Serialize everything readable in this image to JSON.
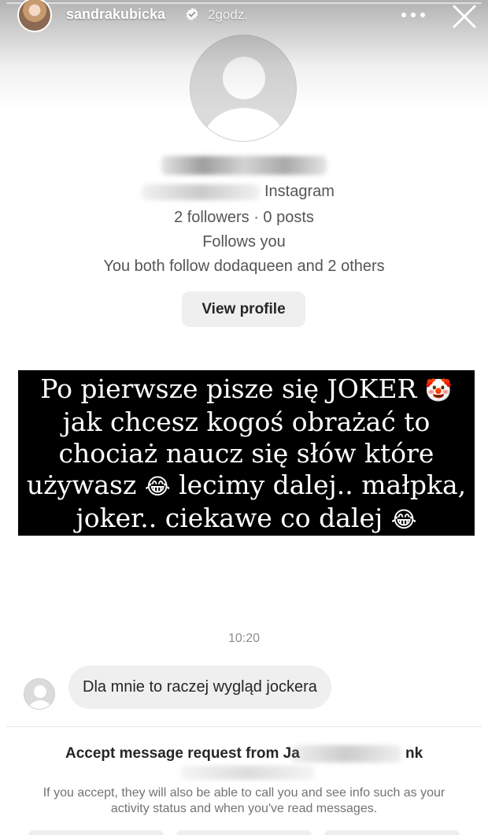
{
  "story": {
    "username": "sandrakubicka",
    "time_ago": "2godz.",
    "verified": true,
    "icons": [
      "verified-badge-icon",
      "more-dots-icon",
      "close-icon"
    ]
  },
  "profile_card": {
    "platform": "Instagram",
    "followers_line": "2 followers · 0 posts",
    "follows_you": "Follows you",
    "mutual_line": "You both follow dodaqueen and 2 others",
    "view_profile_label": "View profile"
  },
  "caption": {
    "text_before_clown": "Po pierwsze pisze się JOKER",
    "clown_emoji": "🤡",
    "text_middle": "jak chcesz kogoś obrażać to chociaż naucz się słów które używasz",
    "laugh_emoji_1": "😂",
    "text_after": "lecimy dalej.. małpka, joker.. ciekawe co dalej",
    "laugh_emoji_2": "😂"
  },
  "chat": {
    "timestamp": "10:20",
    "message": "Dla mnie to raczej wygląd jockera"
  },
  "request": {
    "title_prefix": "Accept message request from Ja",
    "title_suffix": "nk",
    "info": "If you accept, they will also be able to call you and see info such as your activity status and when you've read messages."
  },
  "colors": {
    "caption_background": "#000000",
    "bubble_background": "#efefef",
    "button_background": "#efefef",
    "secondary_text": "#737373"
  }
}
